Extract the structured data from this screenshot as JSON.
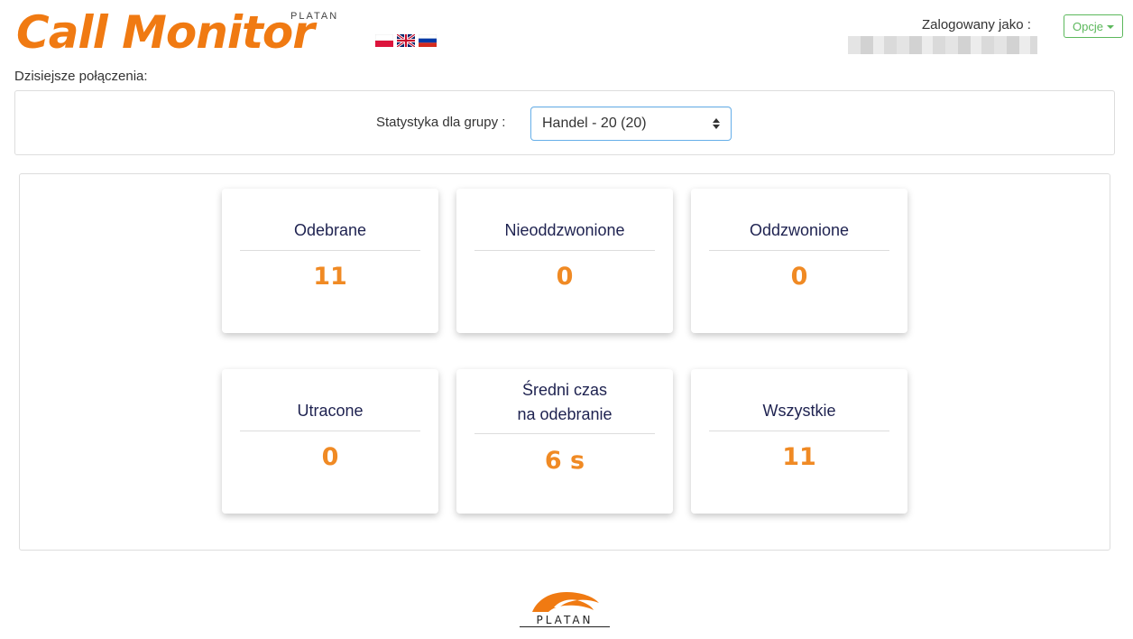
{
  "header": {
    "logo_text": "Call Monitor",
    "logo_sub": "PLATAN",
    "flags": [
      {
        "name": "flag-pl-icon",
        "lang": "pl"
      },
      {
        "name": "flag-gb-icon",
        "lang": "en"
      },
      {
        "name": "flag-ru-icon",
        "lang": "ru"
      }
    ],
    "logged_label": "Zalogowany jako :",
    "options_label": "Opcje"
  },
  "section_title": "Dzisiejsze połączenia:",
  "filter": {
    "label": "Statystyka dla grupy :",
    "selected": "Handel - 20 (20)"
  },
  "stats": [
    {
      "title": "Odebrane",
      "value": "11"
    },
    {
      "title": "Nieoddzwonione",
      "value": "0"
    },
    {
      "title": "Oddzwonione",
      "value": "0"
    },
    {
      "title": "Utracone",
      "value": "0"
    },
    {
      "title": "Średni czas\nna odebranie",
      "value": "6 s"
    },
    {
      "title": "Wszystkie",
      "value": "11"
    }
  ],
  "footer": {
    "logo_text": "PLATAN"
  },
  "colors": {
    "brand_orange": "#f07a12",
    "value_orange": "#f08a24",
    "title_navy": "#1e2250",
    "options_green": "#5cb85c",
    "select_focus_blue": "#66afe9"
  }
}
